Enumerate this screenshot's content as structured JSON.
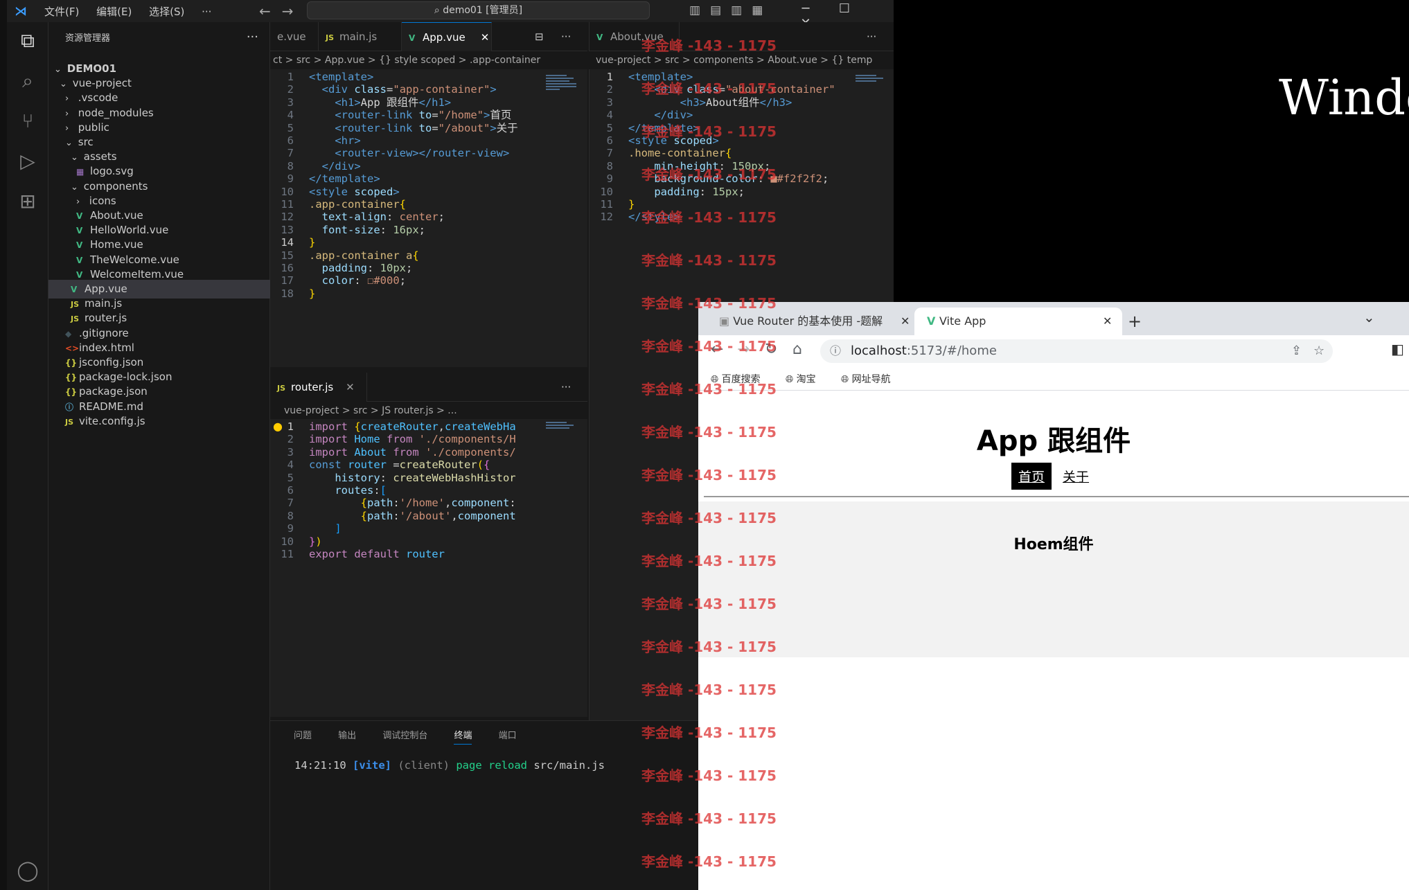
{
  "desktop": {
    "title_text": "Windo"
  },
  "vscode": {
    "menu": [
      "文件(F)",
      "编辑(E)",
      "选择(S)",
      "···"
    ],
    "command_center": "demo01 [管理员]",
    "sidebar": {
      "title": "资源管理器",
      "more": "···",
      "items": [
        {
          "label": "DEMO01",
          "depth": 0,
          "kind": "folder-open",
          "icon": ""
        },
        {
          "label": "vue-project",
          "depth": 1,
          "kind": "folder-open",
          "icon": ""
        },
        {
          "label": ".vscode",
          "depth": 2,
          "kind": "folder",
          "icon": ""
        },
        {
          "label": "node_modules",
          "depth": 2,
          "kind": "folder",
          "icon": ""
        },
        {
          "label": "public",
          "depth": 2,
          "kind": "folder",
          "icon": ""
        },
        {
          "label": "src",
          "depth": 2,
          "kind": "folder-open",
          "icon": ""
        },
        {
          "label": "assets",
          "depth": 3,
          "kind": "folder-open",
          "icon": ""
        },
        {
          "label": "logo.svg",
          "depth": 4,
          "kind": "file",
          "icon": "svg"
        },
        {
          "label": "components",
          "depth": 3,
          "kind": "folder-open",
          "icon": ""
        },
        {
          "label": "icons",
          "depth": 4,
          "kind": "folder",
          "icon": ""
        },
        {
          "label": "About.vue",
          "depth": 4,
          "kind": "file",
          "icon": "vue"
        },
        {
          "label": "HelloWorld.vue",
          "depth": 4,
          "kind": "file",
          "icon": "vue"
        },
        {
          "label": "Home.vue",
          "depth": 4,
          "kind": "file",
          "icon": "vue"
        },
        {
          "label": "TheWelcome.vue",
          "depth": 4,
          "kind": "file",
          "icon": "vue"
        },
        {
          "label": "WelcomeItem.vue",
          "depth": 4,
          "kind": "file",
          "icon": "vue"
        },
        {
          "label": "App.vue",
          "depth": 3,
          "kind": "file",
          "icon": "vue",
          "selected": true
        },
        {
          "label": "main.js",
          "depth": 3,
          "kind": "file",
          "icon": "js"
        },
        {
          "label": "router.js",
          "depth": 3,
          "kind": "file",
          "icon": "js"
        },
        {
          "label": ".gitignore",
          "depth": 2,
          "kind": "file",
          "icon": "git"
        },
        {
          "label": "index.html",
          "depth": 2,
          "kind": "file",
          "icon": "html"
        },
        {
          "label": "jsconfig.json",
          "depth": 2,
          "kind": "file",
          "icon": "json"
        },
        {
          "label": "package-lock.json",
          "depth": 2,
          "kind": "file",
          "icon": "json"
        },
        {
          "label": "package.json",
          "depth": 2,
          "kind": "file",
          "icon": "json"
        },
        {
          "label": "README.md",
          "depth": 2,
          "kind": "file",
          "icon": "md"
        },
        {
          "label": "vite.config.js",
          "depth": 2,
          "kind": "file",
          "icon": "js"
        }
      ]
    },
    "group1": {
      "tabs": [
        {
          "label": "e.vue",
          "icon": ""
        },
        {
          "label": "main.js",
          "icon": "JS"
        },
        {
          "label": "App.vue",
          "icon": "V",
          "active": true,
          "close": "✕"
        }
      ],
      "more": "···",
      "breadcrumb": "ct  >  src  >  App.vue  >  {} style scoped  >  .app-container",
      "current_line": 14,
      "lines": [
        [
          [
            "t-tag",
            "<template>"
          ]
        ],
        [
          [
            "t-txt",
            "  "
          ],
          [
            "t-tag",
            "<div "
          ],
          [
            "t-attr",
            "class"
          ],
          [
            "t-txt",
            "="
          ],
          [
            "t-str",
            "\"app-container\""
          ],
          [
            "t-tag",
            ">"
          ]
        ],
        [
          [
            "t-txt",
            "    "
          ],
          [
            "t-tag",
            "<h1>"
          ],
          [
            "t-txt",
            "App 跟组件"
          ],
          [
            "t-tag",
            "</h1>"
          ]
        ],
        [
          [
            "t-txt",
            "    "
          ],
          [
            "t-tag",
            "<router-link "
          ],
          [
            "t-attr",
            "to"
          ],
          [
            "t-txt",
            "="
          ],
          [
            "t-str",
            "\"/home\""
          ],
          [
            "t-tag",
            ">"
          ],
          [
            "t-txt",
            "首页"
          ]
        ],
        [
          [
            "t-txt",
            "    "
          ],
          [
            "t-tag",
            "<router-link "
          ],
          [
            "t-attr",
            "to"
          ],
          [
            "t-txt",
            "="
          ],
          [
            "t-str",
            "\"/about\""
          ],
          [
            "t-tag",
            ">"
          ],
          [
            "t-txt",
            "关于"
          ]
        ],
        [
          [
            "t-txt",
            "    "
          ],
          [
            "t-tag",
            "<hr>"
          ]
        ],
        [
          [
            "t-txt",
            "    "
          ],
          [
            "t-tag",
            "<router-view></router-view>"
          ]
        ],
        [
          [
            "t-txt",
            "  "
          ],
          [
            "t-tag",
            "</div>"
          ]
        ],
        [
          [
            "t-tag",
            "</template>"
          ]
        ],
        [
          [
            "t-tag",
            "<style "
          ],
          [
            "t-attr",
            "scoped"
          ],
          [
            "t-tag",
            ">"
          ]
        ],
        [
          [
            "t-sel",
            ".app-container"
          ],
          [
            "t-brk",
            "{"
          ]
        ],
        [
          [
            "t-txt",
            "  "
          ],
          [
            "t-prop",
            "text-align"
          ],
          [
            "t-txt",
            ": "
          ],
          [
            "t-val",
            "center"
          ],
          [
            "t-txt",
            ";"
          ]
        ],
        [
          [
            "t-txt",
            "  "
          ],
          [
            "t-prop",
            "font-size"
          ],
          [
            "t-txt",
            ": "
          ],
          [
            "t-num",
            "16px"
          ],
          [
            "t-txt",
            ";"
          ]
        ],
        [
          [
            "t-brk",
            "}"
          ]
        ],
        [
          [
            "t-sel",
            ".app-container a"
          ],
          [
            "t-brk",
            "{"
          ]
        ],
        [
          [
            "t-txt",
            "  "
          ],
          [
            "t-prop",
            "padding"
          ],
          [
            "t-txt",
            ": "
          ],
          [
            "t-num",
            "10px"
          ],
          [
            "t-txt",
            ";"
          ]
        ],
        [
          [
            "t-txt",
            "  "
          ],
          [
            "t-prop",
            "color"
          ],
          [
            "t-txt",
            ": "
          ],
          [
            "t-val",
            "☐#000"
          ],
          [
            "t-txt",
            ";"
          ]
        ],
        [
          [
            "t-brk",
            "}"
          ]
        ]
      ]
    },
    "group2": {
      "tabs": [
        {
          "label": "router.js",
          "icon": "JS",
          "active": true,
          "close": "✕"
        }
      ],
      "more": "···",
      "breadcrumb": "vue-project  >  src  >  JS router.js  >  ...",
      "current_line": 1,
      "lines": [
        [
          [
            "t-kw",
            "import "
          ],
          [
            "t-brk",
            "{"
          ],
          [
            "t-var",
            "createRouter"
          ],
          [
            "t-txt",
            ","
          ],
          [
            "t-var",
            "createWebHa"
          ]
        ],
        [
          [
            "t-kw",
            "import "
          ],
          [
            "t-var",
            "Home "
          ],
          [
            "t-kw",
            "from "
          ],
          [
            "t-str",
            "'./components/H"
          ]
        ],
        [
          [
            "t-kw",
            "import "
          ],
          [
            "t-var",
            "About "
          ],
          [
            "t-kw",
            "from "
          ],
          [
            "t-str",
            "'./components/"
          ]
        ],
        [
          [
            "t-blu",
            "const "
          ],
          [
            "t-var",
            "router "
          ],
          [
            "t-txt",
            "="
          ],
          [
            "t-fn",
            "createRouter"
          ],
          [
            "t-brk",
            "("
          ],
          [
            "t-brk2",
            "{"
          ]
        ],
        [
          [
            "t-txt",
            "    "
          ],
          [
            "t-prop",
            "history"
          ],
          [
            "t-txt",
            ": "
          ],
          [
            "t-fn",
            "createWebHashHistor"
          ]
        ],
        [
          [
            "t-txt",
            "    "
          ],
          [
            "t-prop",
            "routes"
          ],
          [
            "t-txt",
            ":"
          ],
          [
            "t-brk3",
            "["
          ]
        ],
        [
          [
            "t-txt",
            "        "
          ],
          [
            "t-brk",
            "{"
          ],
          [
            "t-prop",
            "path"
          ],
          [
            "t-txt",
            ":"
          ],
          [
            "t-str",
            "'/home'"
          ],
          [
            "t-txt",
            ","
          ],
          [
            "t-prop",
            "component"
          ],
          [
            "t-txt",
            ":"
          ]
        ],
        [
          [
            "t-txt",
            "        "
          ],
          [
            "t-brk",
            "{"
          ],
          [
            "t-prop",
            "path"
          ],
          [
            "t-txt",
            ":"
          ],
          [
            "t-str",
            "'/about'"
          ],
          [
            "t-txt",
            ","
          ],
          [
            "t-prop",
            "component"
          ]
        ],
        [
          [
            "t-txt",
            "    "
          ],
          [
            "t-brk3",
            "]"
          ]
        ],
        [
          [
            "t-brk2",
            "}"
          ],
          [
            "t-brk",
            ")"
          ]
        ],
        [
          [
            "t-kw",
            "export "
          ],
          [
            "t-kw",
            "default "
          ],
          [
            "t-var",
            "router"
          ]
        ]
      ]
    },
    "group3": {
      "tabs": [
        {
          "label": "About.vue",
          "icon": "V"
        }
      ],
      "more": "···",
      "breadcrumb": "vue-project  >  src  >  components  >  About.vue  >  {} temp",
      "current_line": 1,
      "lines": [
        [
          [
            "t-tag",
            "<template>"
          ]
        ],
        [
          [
            "t-txt",
            "    "
          ],
          [
            "t-tag",
            "<div "
          ],
          [
            "t-attr",
            "class"
          ],
          [
            "t-txt",
            "="
          ],
          [
            "t-str",
            "\"about-container\""
          ]
        ],
        [
          [
            "t-txt",
            "        "
          ],
          [
            "t-tag",
            "<h3>"
          ],
          [
            "t-txt",
            "About组件"
          ],
          [
            "t-tag",
            "</h3>"
          ]
        ],
        [
          [
            "t-txt",
            "    "
          ],
          [
            "t-tag",
            "</div>"
          ]
        ],
        [
          [
            "t-tag",
            "</template>"
          ]
        ],
        [
          [
            "t-tag",
            "<style "
          ],
          [
            "t-attr",
            "scoped"
          ],
          [
            "t-tag",
            ">"
          ]
        ],
        [
          [
            "t-sel",
            ".home-container"
          ],
          [
            "t-brk",
            "{"
          ]
        ],
        [
          [
            "t-txt",
            "    "
          ],
          [
            "t-prop",
            "min-height"
          ],
          [
            "t-txt",
            ": "
          ],
          [
            "t-num",
            "150px"
          ],
          [
            "t-txt",
            ";"
          ]
        ],
        [
          [
            "t-txt",
            "    "
          ],
          [
            "t-prop",
            "background-color"
          ],
          [
            "t-txt",
            ": "
          ],
          [
            "t-val",
            "■#f2f2f2"
          ],
          [
            "t-txt",
            ";"
          ]
        ],
        [
          [
            "t-txt",
            "    "
          ],
          [
            "t-prop",
            "padding"
          ],
          [
            "t-txt",
            ": "
          ],
          [
            "t-num",
            "15px"
          ],
          [
            "t-txt",
            ";"
          ]
        ],
        [
          [
            "t-brk",
            "}"
          ]
        ],
        [
          [
            "t-tag",
            "</style>"
          ]
        ]
      ]
    },
    "panel": {
      "tabs": [
        "问题",
        "输出",
        "调试控制台",
        "终端",
        "端口"
      ],
      "active_tab": "终端",
      "terminal": {
        "time": "14:21:10",
        "tag": "[vite]",
        "source": "(client)",
        "action": "page reload",
        "file": "src/main.js"
      }
    }
  },
  "browser": {
    "tabs": [
      {
        "label": "Vue Router 的基本使用 -题解",
        "close": "✕"
      },
      {
        "label": "Vite App",
        "close": "✕",
        "active": true
      }
    ],
    "new_tab": "+",
    "dropdown": "⌄",
    "url_host": "localhost",
    "url_rest": ":5173/#/home",
    "bookmarks": [
      "百度搜索",
      "淘宝",
      "网址导航"
    ],
    "page": {
      "h1": "App 跟组件",
      "links": [
        {
          "label": "首页",
          "active": true
        },
        {
          "label": "关于",
          "active": false
        }
      ],
      "home_h3": "Hoem组件"
    }
  },
  "watermark": "李金峰 -143 - 1175",
  "colors": {
    "accent": "#0078d4",
    "vue": "#41b883",
    "watermark": "#dd3333"
  }
}
